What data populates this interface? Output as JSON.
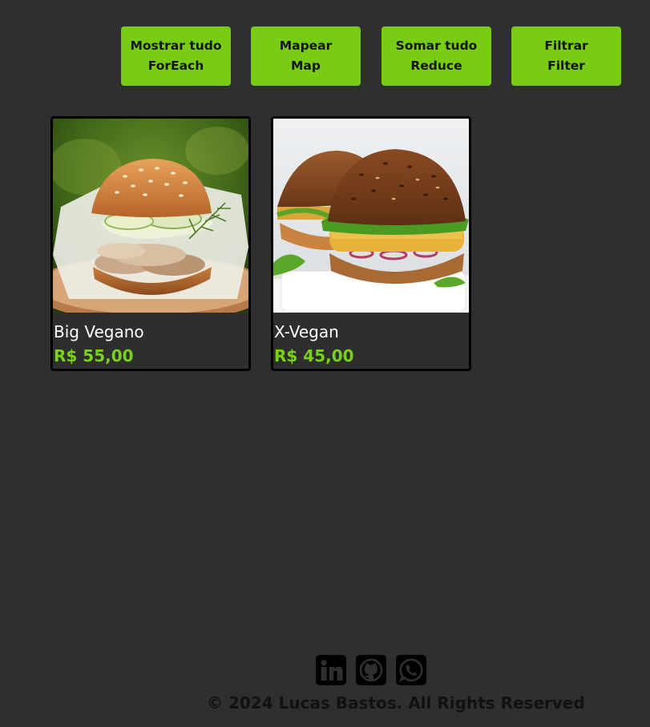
{
  "toolbar": {
    "buttons": [
      {
        "label": "Mostrar tudo",
        "sublabel": "ForEach"
      },
      {
        "label": "Mapear",
        "sublabel": "Map"
      },
      {
        "label": "Somar tudo",
        "sublabel": "Reduce"
      },
      {
        "label": "Filtrar",
        "sublabel": "Filter"
      }
    ]
  },
  "products": [
    {
      "name": "Big Vegano",
      "price": "R$ 55,00",
      "image": "burger-mushroom-cucumber-dill-photo"
    },
    {
      "name": "X-Vegan",
      "price": "R$ 45,00",
      "image": "veggie-burgers-arugula-photo"
    }
  ],
  "footer": {
    "socials": [
      {
        "name": "LinkedIn",
        "icon": "linkedin-icon"
      },
      {
        "name": "GitHub",
        "icon": "github-icon"
      },
      {
        "name": "WhatsApp",
        "icon": "whatsapp-icon"
      }
    ],
    "copyright": "© 2024 Lucas Bastos. All Rights Reserved"
  },
  "colors": {
    "background": "#302f2f",
    "accent": "#78cc14",
    "price": "#7ad11a",
    "card_border": "#000000"
  }
}
